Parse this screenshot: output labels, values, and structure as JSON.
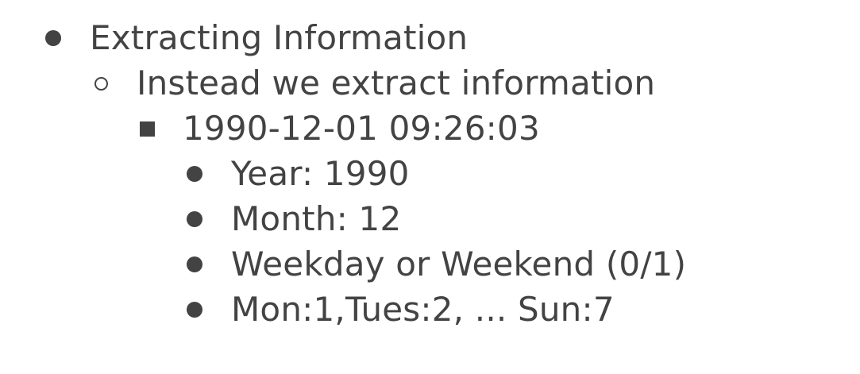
{
  "items": [
    {
      "level": 1,
      "bullet": "disc",
      "text": "Extracting Information"
    },
    {
      "level": 2,
      "bullet": "circle",
      "text": "Instead we extract information"
    },
    {
      "level": 3,
      "bullet": "square",
      "text": "1990-12-01 09:26:03"
    },
    {
      "level": 4,
      "bullet": "disc",
      "text": "Year: 1990"
    },
    {
      "level": 4,
      "bullet": "disc",
      "text": "Month: 12"
    },
    {
      "level": 4,
      "bullet": "disc",
      "text": "Weekday or Weekend (0/1)"
    },
    {
      "level": 4,
      "bullet": "disc",
      "text": "Mon:1,Tues:2, ... Sun:7"
    }
  ],
  "colors": {
    "text": "#434343",
    "background": "#ffffff"
  }
}
